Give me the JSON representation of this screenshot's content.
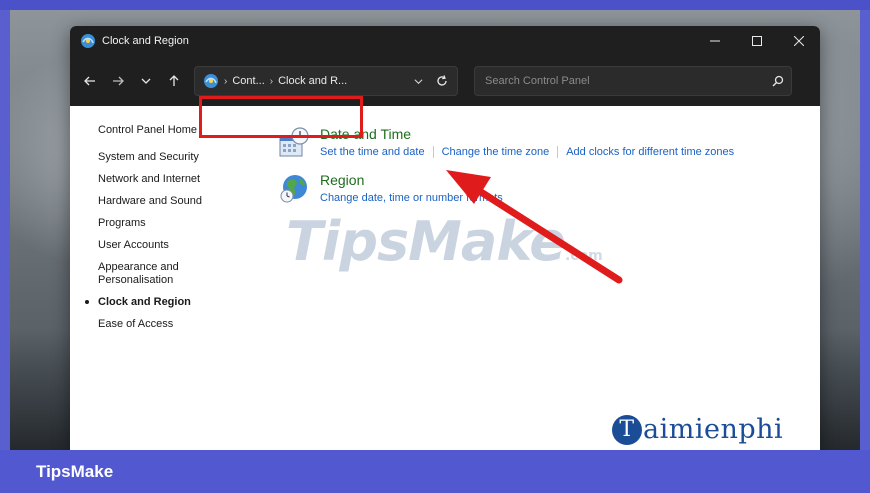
{
  "window": {
    "title": "Clock and Region"
  },
  "address": {
    "crumbs": [
      "Cont...",
      "Clock and R..."
    ],
    "search_placeholder": "Search Control Panel"
  },
  "sidebar": {
    "home": "Control Panel Home",
    "items": [
      {
        "label": "System and Security",
        "active": false
      },
      {
        "label": "Network and Internet",
        "active": false
      },
      {
        "label": "Hardware and Sound",
        "active": false
      },
      {
        "label": "Programs",
        "active": false
      },
      {
        "label": "User Accounts",
        "active": false
      },
      {
        "label": "Appearance and Personalisation",
        "active": false
      },
      {
        "label": "Clock and Region",
        "active": true
      },
      {
        "label": "Ease of Access",
        "active": false
      }
    ]
  },
  "categories": {
    "datetime": {
      "title": "Date and Time",
      "links": [
        "Set the time and date",
        "Change the time zone",
        "Add clocks for different time zones"
      ]
    },
    "region": {
      "title": "Region",
      "links": [
        "Change date, time or number formats"
      ]
    }
  },
  "watermark": {
    "main": "TipsMake",
    "suffix": ".com"
  },
  "brand_logo": {
    "initial": "T",
    "rest": "aimienphi"
  },
  "footer": {
    "brand": "TipsMake"
  },
  "colors": {
    "footer_bar": "#5258cf",
    "category_title": "#1e6d1e",
    "link": "#1a62c4",
    "highlight": "#e01b1b"
  }
}
